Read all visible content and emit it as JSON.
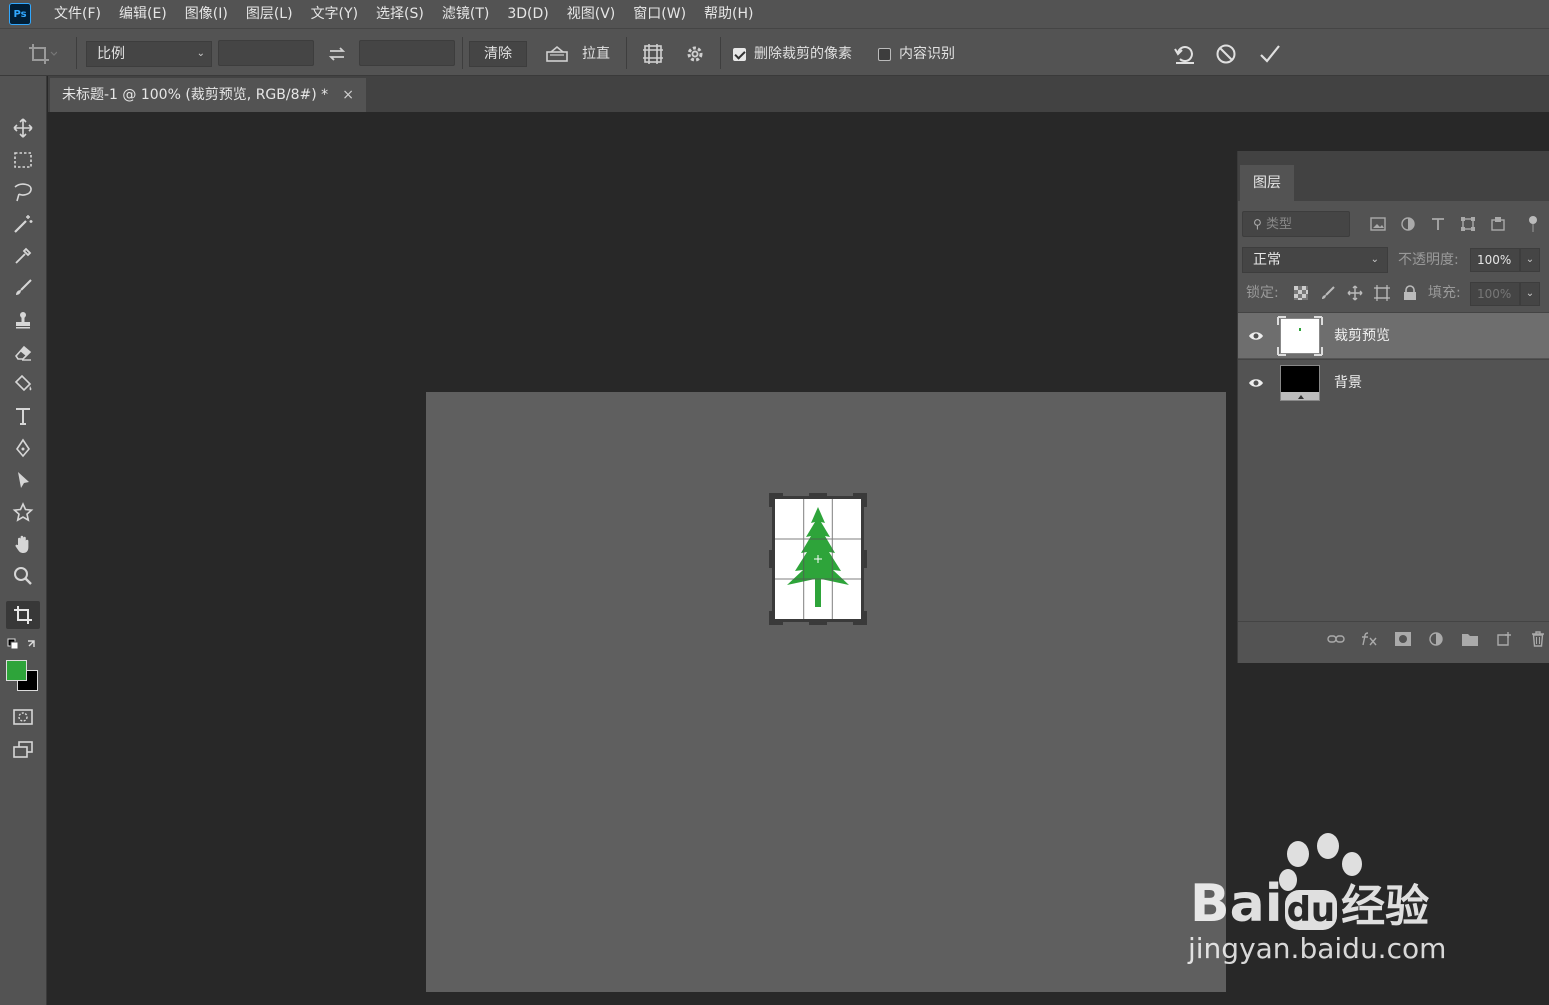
{
  "app": {
    "logo": "Ps"
  },
  "menu": [
    "文件(F)",
    "编辑(E)",
    "图像(I)",
    "图层(L)",
    "文字(Y)",
    "选择(S)",
    "滤镜(T)",
    "3D(D)",
    "视图(V)",
    "窗口(W)",
    "帮助(H)"
  ],
  "options": {
    "ratio_select": "比例",
    "width_value": "",
    "height_value": "",
    "clear_label": "清除",
    "straighten_label": "拉直",
    "delete_cropped_label": "删除裁剪的像素",
    "delete_cropped_checked": true,
    "content_aware_label": "内容识别",
    "content_aware_checked": false
  },
  "document_tab": {
    "title": "未标题-1 @ 100% (裁剪预览, RGB/8#) *",
    "close": "×"
  },
  "colors": {
    "foreground": "#2ea43a",
    "background": "#000000",
    "tree": "#2ea43a"
  },
  "layers_panel": {
    "tab_label": "图层",
    "search_placeholder": "类型",
    "blend_mode": "正常",
    "opacity_label": "不透明度:",
    "opacity_value": "100%",
    "lock_label": "锁定:",
    "fill_label": "填充:",
    "fill_value": "100%",
    "layers": [
      {
        "name": "裁剪预览",
        "selected": true
      },
      {
        "name": "背景",
        "selected": false
      }
    ]
  },
  "watermark": {
    "brand": "Bai",
    "brand_du": "du",
    "brand_cn": "经验",
    "url": "jingyan.baidu.com"
  }
}
